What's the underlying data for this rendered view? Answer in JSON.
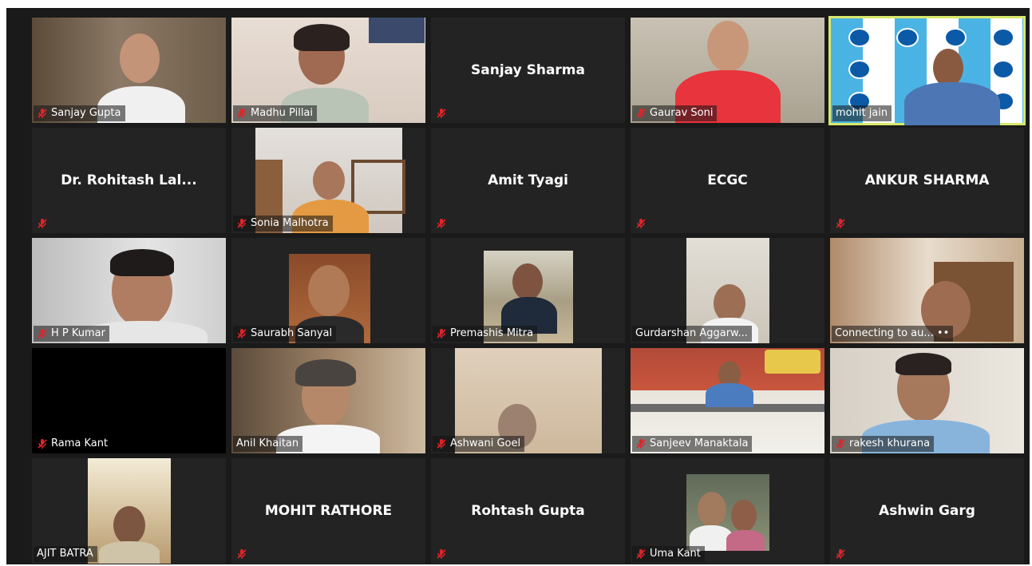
{
  "participants": [
    {
      "name": "Sanjay Gupta",
      "video": true,
      "muted": true
    },
    {
      "name": "Madhu Pillai",
      "video": true,
      "muted": true
    },
    {
      "name": "Sanjay Sharma",
      "video": false,
      "muted": true
    },
    {
      "name": "Gaurav Soni",
      "video": true,
      "muted": true
    },
    {
      "name": "mohit jain",
      "video": true,
      "muted": false,
      "active_speaker": true
    },
    {
      "name": "Dr. Rohitash Lal...",
      "video": false,
      "muted": true
    },
    {
      "name": "Sonia Malhotra",
      "video": true,
      "muted": true
    },
    {
      "name": "Amit Tyagi",
      "video": false,
      "muted": true
    },
    {
      "name": "ECGC",
      "video": false,
      "muted": true
    },
    {
      "name": "ANKUR SHARMA",
      "video": false,
      "muted": true
    },
    {
      "name": "H P Kumar",
      "video": true,
      "muted": true
    },
    {
      "name": "Saurabh Sanyal",
      "video": true,
      "muted": true
    },
    {
      "name": "Premashis Mitra",
      "video": true,
      "muted": true
    },
    {
      "name": "Gurdarshan Aggarw...",
      "video": true,
      "muted": false
    },
    {
      "name": "Connecting to au... ••",
      "video": true,
      "muted": false
    },
    {
      "name": "Rama Kant",
      "video": false,
      "muted": true
    },
    {
      "name": "Anil Khaitan",
      "video": true,
      "muted": false
    },
    {
      "name": "Ashwani Goel",
      "video": true,
      "muted": true
    },
    {
      "name": "Sanjeev Manaktala",
      "video": true,
      "muted": true
    },
    {
      "name": "rakesh khurana",
      "video": true,
      "muted": true
    },
    {
      "name": "AJIT BATRA",
      "video": true,
      "muted": false
    },
    {
      "name": "MOHIT RATHORE",
      "video": false,
      "muted": true
    },
    {
      "name": "Rohtash Gupta",
      "video": false,
      "muted": true
    },
    {
      "name": "Uma Kant",
      "video": true,
      "muted": true
    },
    {
      "name": "Ashwin Garg",
      "video": false,
      "muted": true
    }
  ],
  "colors": {
    "background": "#1a1a1a",
    "tile": "#232323",
    "active_speaker_border": "#d8e86a",
    "muted_icon": "#e0242a",
    "label_text": "#ffffff"
  },
  "icons": {
    "muted": "muted-microphone-icon"
  }
}
